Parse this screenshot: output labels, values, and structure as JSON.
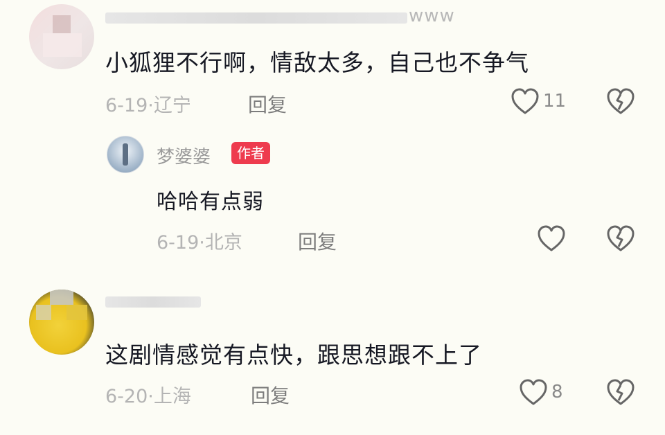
{
  "comments": [
    {
      "username_suffix": "www",
      "text": "小狐狸不行啊，情敌太多，自己也不争气",
      "meta": "6-19·辽宁",
      "reply_label": "回复",
      "like_count": "11",
      "icons": [
        "heart-outline-icon",
        "broken-heart-icon"
      ]
    },
    {
      "text": "这剧情感觉有点快，跟思想跟不上了",
      "meta": "6-20·上海",
      "reply_label": "回复",
      "like_count": "8",
      "icons": [
        "heart-outline-icon",
        "broken-heart-icon"
      ]
    }
  ],
  "reply": {
    "nickname": "梦婆婆",
    "badge": "作者",
    "text": "哈哈有点弱",
    "meta": "6-19·北京",
    "reply_label": "回复",
    "icons": [
      "heart-outline-icon",
      "broken-heart-icon"
    ]
  },
  "colors": {
    "background": "#fcfcf5",
    "badge": "#ee3b4e",
    "text": "#161823",
    "meta": "#b4b4b4"
  }
}
